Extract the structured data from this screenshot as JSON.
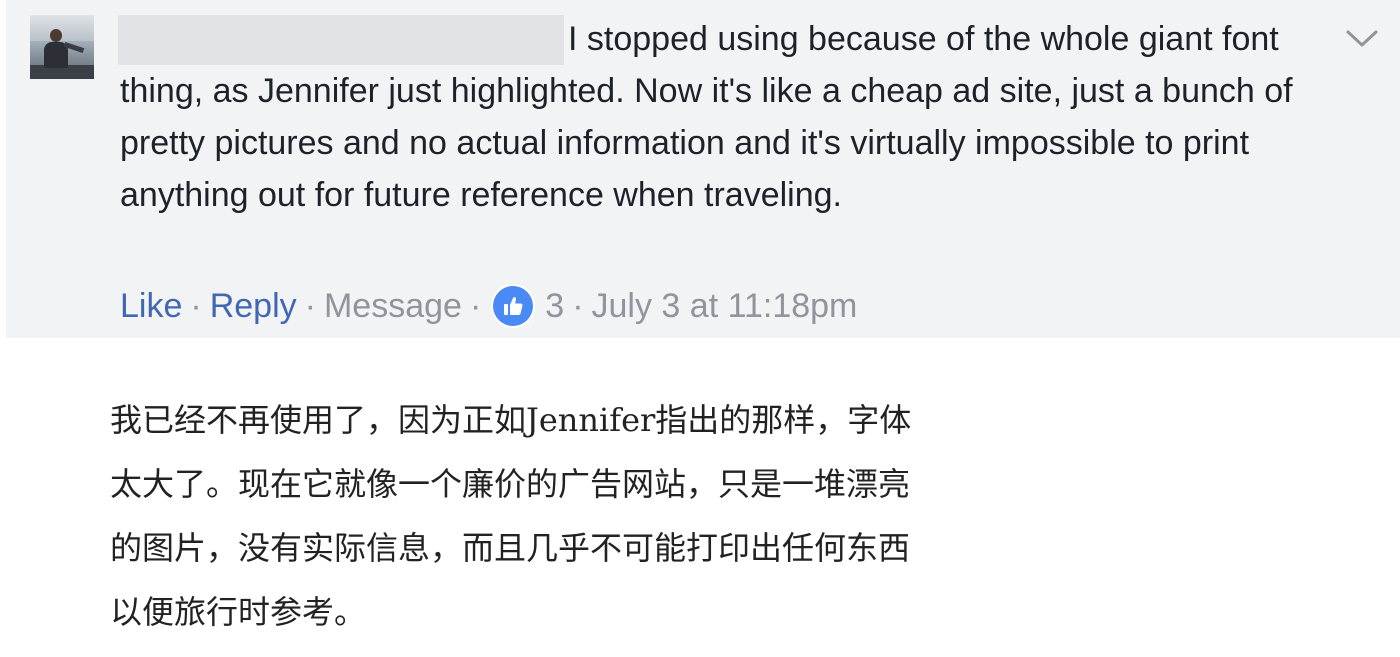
{
  "comment": {
    "text": "I stopped using because of the whole giant font thing, as Jennifer just highlighted. Now it's like a cheap ad site, just a bunch of pretty pictures and no actual information and it's virtually impossible to print anything out for future reference when traveling.",
    "actions": {
      "like_label": "Like",
      "reply_label": "Reply",
      "message_label": "Message",
      "separator": "·",
      "like_count": "3",
      "timestamp": "July 3 at 11:18pm"
    }
  },
  "translation": {
    "text": "我已经不再使用了，因为正如Jennifer指出的那样，字体太大了。现在它就像一个廉价的广告网站，只是一堆漂亮的图片，没有实际信息，而且几乎不可能打印出任何东西以便旅行时参考。"
  },
  "icons": {
    "avatar": "user-photo",
    "options": "chevron-down-icon",
    "reaction": "thumbs-up-icon"
  },
  "colors": {
    "card_background": "#f2f3f5",
    "link": "#4267b2",
    "meta_text": "#90949c",
    "like_badge": "#4a8af4",
    "body_text": "#1d2129"
  }
}
